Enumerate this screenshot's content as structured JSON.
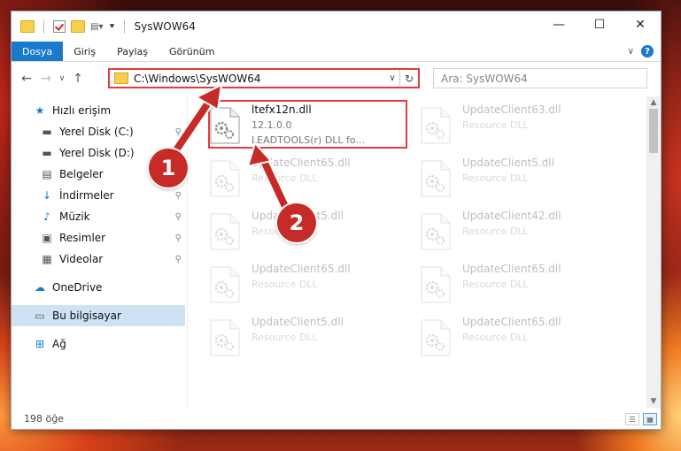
{
  "window": {
    "title": "SysWOW64",
    "controls": {
      "minimize": "—",
      "maximize": "☐",
      "close": "✕"
    }
  },
  "ribbon": {
    "tabs": [
      "Dosya",
      "Giriş",
      "Paylaş",
      "Görünüm"
    ],
    "expand_glyph": "∨",
    "help_glyph": "?"
  },
  "nav": {
    "back": "←",
    "forward": "→",
    "recent": "∨",
    "up": "↑",
    "address": "C:\\Windows\\SysWOW64",
    "address_dropdown": "∨",
    "refresh": "↻",
    "search_placeholder": "Ara: SysWOW64"
  },
  "sidebar": {
    "items": [
      {
        "label": "Hızlı erişim",
        "icon": "star-icon",
        "glyph": "★"
      },
      {
        "label": "Yerel Disk (C:)",
        "icon": "drive-icon",
        "glyph": "▬",
        "pinned": true
      },
      {
        "label": "Yerel Disk (D:)",
        "icon": "drive-icon",
        "glyph": "▬",
        "pinned": true
      },
      {
        "label": "Belgeler",
        "icon": "documents-icon",
        "glyph": "▤",
        "pinned": true
      },
      {
        "label": "İndirmeler",
        "icon": "download-icon",
        "glyph": "↓",
        "pinned": true
      },
      {
        "label": "Müzik",
        "icon": "music-icon",
        "glyph": "♪",
        "pinned": true
      },
      {
        "label": "Resimler",
        "icon": "pictures-icon",
        "glyph": "▣",
        "pinned": true
      },
      {
        "label": "Videolar",
        "icon": "video-icon",
        "glyph": "▦",
        "pinned": true
      },
      {
        "label": "OneDrive",
        "icon": "cloud-icon",
        "glyph": "☁"
      },
      {
        "label": "Bu bilgisayar",
        "icon": "computer-icon",
        "glyph": "▭",
        "selected": true
      },
      {
        "label": "Ağ",
        "icon": "network-icon",
        "glyph": "⊞"
      }
    ],
    "pin_glyph": "📌"
  },
  "files": [
    {
      "name": "ltefx12n.dll",
      "line2": "12.1.0.0",
      "line3": "LEADTOOLS(r) DLL fo...",
      "highlighted": true
    },
    {
      "name": "UpdateClient63.dll",
      "line2": "Resource DLL",
      "line3": ""
    },
    {
      "name": "UpdateClient65.dll",
      "line2": "Resource DLL",
      "line3": ""
    },
    {
      "name": "UpdateClient5.dll",
      "line2": "Resource DLL",
      "line3": ""
    },
    {
      "name": "UpdateClient5.dll",
      "line2": "Resource DLL",
      "line3": ""
    },
    {
      "name": "UpdateClient42.dll",
      "line2": "Resource DLL",
      "line3": ""
    },
    {
      "name": "UpdateClient65.dll",
      "line2": "Resource DLL",
      "line3": ""
    },
    {
      "name": "UpdateClient65.dll",
      "line2": "Resource DLL",
      "line3": ""
    },
    {
      "name": "UpdateClient5.dll",
      "line2": "Resource DLL",
      "line3": ""
    },
    {
      "name": "UpdateClient65.dll",
      "line2": "Resource DLL",
      "line3": ""
    }
  ],
  "status": {
    "count": "198 öğe"
  },
  "annotations": {
    "callout1": "1",
    "callout2": "2",
    "color": "#c62b28"
  },
  "colors": {
    "accent": "#1979ca",
    "highlight": "#e53a3a",
    "selected_bg": "#cde3f5"
  }
}
